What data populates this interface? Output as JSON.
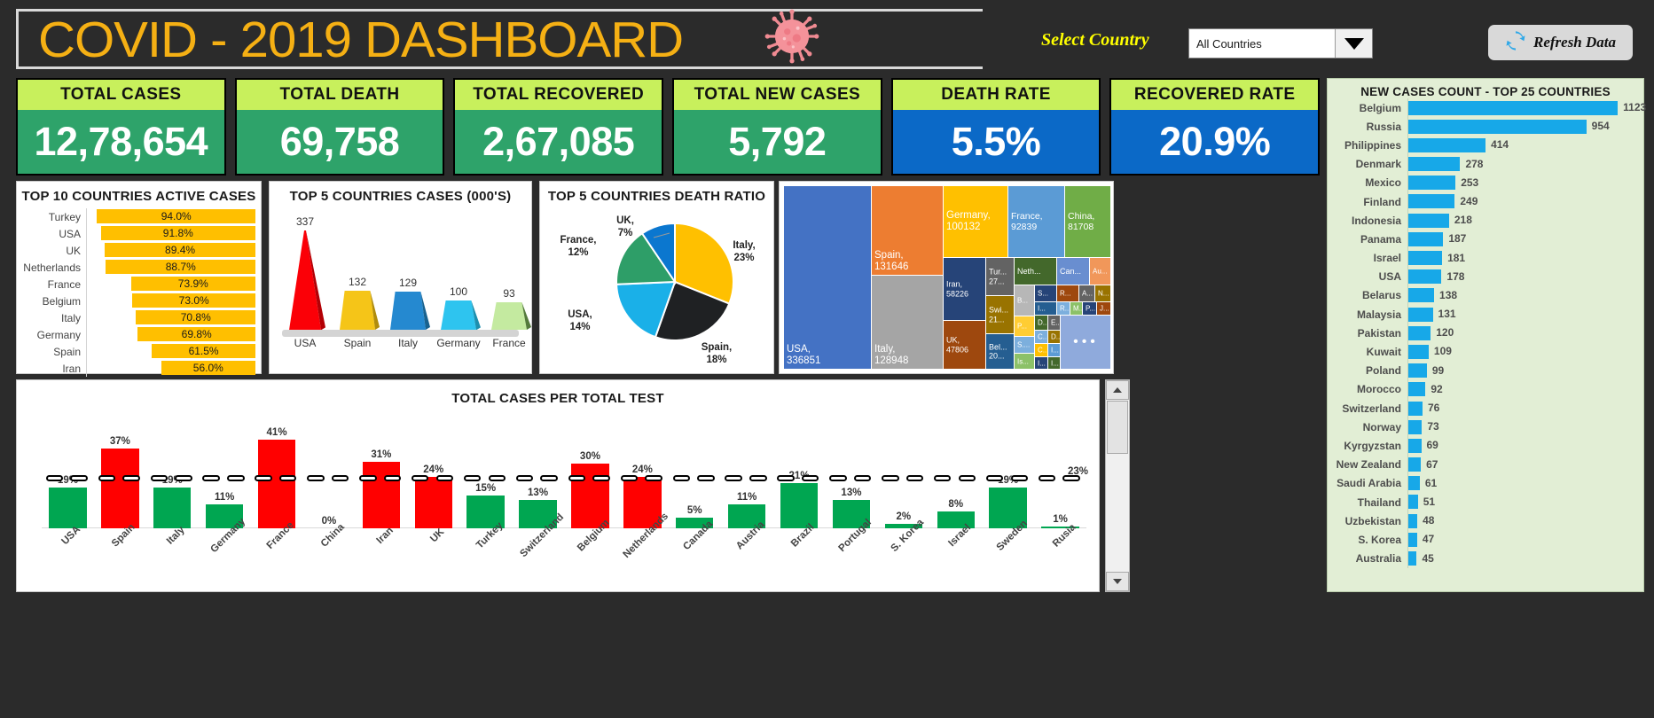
{
  "header": {
    "title": "COVID - 2019 DASHBOARD",
    "virus_icon": "coronavirus-icon",
    "select_country_label": "Select Country",
    "country_value": "All Countries",
    "country_caret_icon": "chevron-down-icon",
    "refresh_label": "Refresh Data",
    "refresh_icon": "refresh-icon"
  },
  "kpis": [
    {
      "caption": "TOTAL CASES",
      "value": "12,78,654",
      "color": "#2ea36a"
    },
    {
      "caption": "TOTAL DEATH",
      "value": "69,758",
      "color": "#2ea36a"
    },
    {
      "caption": "TOTAL RECOVERED",
      "value": "2,67,085",
      "color": "#2ea36a"
    },
    {
      "caption": "TOTAL NEW CASES",
      "value": "5,792",
      "color": "#2ea36a"
    },
    {
      "caption": "DEATH RATE",
      "value": "5.5%",
      "color": "#0b69c7"
    },
    {
      "caption": "RECOVERED RATE",
      "value": "20.9%",
      "color": "#0b69c7"
    }
  ],
  "chart_data": [
    {
      "type": "bar",
      "id": "active_cases",
      "title": "TOP 10 COUNTRIES ACTIVE CASES",
      "orientation": "horizontal",
      "xlabel": "",
      "ylabel": "",
      "grid": false,
      "legend": false,
      "bar_color": "#ffbf00",
      "categories": [
        "Turkey",
        "USA",
        "UK",
        "Netherlands",
        "France",
        "Belgium",
        "Italy",
        "Germany",
        "Spain",
        "Iran"
      ],
      "values": [
        94.0,
        91.8,
        89.4,
        88.7,
        73.9,
        73.0,
        70.8,
        69.8,
        61.5,
        56.0
      ],
      "labels": [
        "94.0%",
        "91.8%",
        "89.4%",
        "88.7%",
        "73.9%",
        "73.0%",
        "70.8%",
        "69.8%",
        "61.5%",
        "56.0%"
      ]
    },
    {
      "type": "bar",
      "id": "top5_cases",
      "title": "TOP 5 COUNTRIES CASES (000'S)",
      "orientation": "vertical",
      "shape": "cone-pyramid",
      "xlabel": "",
      "ylabel": "",
      "grid": false,
      "legend": false,
      "categories": [
        "USA",
        "Spain",
        "Italy",
        "Germany",
        "France"
      ],
      "values": [
        337,
        132,
        129,
        100,
        93
      ],
      "labels": [
        "337",
        "132",
        "129",
        "100",
        "93"
      ],
      "colors": [
        "#fb0007",
        "#f5c518",
        "#2589d0",
        "#2ec4ef",
        "#c4eaa0"
      ]
    },
    {
      "type": "pie",
      "id": "death_ratio",
      "title": "TOP 5 COUNTRIES DEATH RATIO",
      "legend": false,
      "categories": [
        "Italy",
        "Spain",
        "USA",
        "France",
        "UK"
      ],
      "values": [
        23,
        18,
        14,
        12,
        7
      ],
      "labels": [
        "Italy, 23%",
        "Spain, 18%",
        "USA, 14%",
        "France, 12%",
        "UK, 7%"
      ],
      "colors": [
        "#ffc000",
        "#1f2123",
        "#1ab0e8",
        "#2e9e68",
        "#0b77cf"
      ]
    },
    {
      "type": "heatmap",
      "id": "treemap_total_cases",
      "title": "",
      "subtype": "treemap",
      "items": [
        {
          "label": "USA, 336851",
          "value": 336851,
          "color": "#4472c4"
        },
        {
          "label": "Spain, 131646",
          "value": 131646,
          "color": "#ed7d31"
        },
        {
          "label": "Italy, 128948",
          "value": 128948,
          "color": "#a5a5a5"
        },
        {
          "label": "Germany, 100132",
          "value": 100132,
          "color": "#ffc000"
        },
        {
          "label": "France, 92839",
          "value": 92839,
          "color": "#5b9bd5"
        },
        {
          "label": "China, 81708",
          "value": 81708,
          "color": "#70ad47"
        },
        {
          "label": "Iran, 58226",
          "value": 58226,
          "color": "#264478"
        },
        {
          "label": "UK, 47806",
          "value": 47806,
          "color": "#9e480e"
        },
        {
          "label": "Tur... 27...",
          "value": 27069,
          "color": "#636363"
        },
        {
          "label": "Swi... 21...",
          "value": 21100,
          "color": "#997300"
        },
        {
          "label": "Bel... 20...",
          "value": 20814,
          "color": "#255e91"
        },
        {
          "label": "Neth...",
          "value": 18803,
          "color": "#43682b"
        },
        {
          "label": "Can...",
          "value": 16563,
          "color": "#698ed0"
        },
        {
          "label": "Au...",
          "value": 11781,
          "color": "#f1975a"
        },
        {
          "label": "B...",
          "value": 11130,
          "color": "#b7b7b7"
        },
        {
          "label": "P...",
          "value": 11130,
          "color": "#ffcd33"
        },
        {
          "label": "S....",
          "value": 10331,
          "color": "#7cafdd"
        },
        {
          "label": "Is...",
          "value": 9006,
          "color": "#8cc168"
        },
        {
          "label": "S...",
          "value": 8961,
          "color": "#264478"
        },
        {
          "label": "R...",
          "value": 8672,
          "color": "#9e480e"
        },
        {
          "label": "A...",
          "value": 8271,
          "color": "#636363"
        },
        {
          "label": "N...",
          "value": 7997,
          "color": "#997300"
        },
        {
          "label": "I...",
          "value": 7600,
          "color": "#255e91"
        },
        {
          "label": "R...",
          "value": 7000,
          "color": "#7cafdd"
        },
        {
          "label": "M...",
          "value": 6800,
          "color": "#8cc168"
        },
        {
          "label": "P...",
          "value": 6600,
          "color": "#264478"
        },
        {
          "label": "J...",
          "value": 6400,
          "color": "#9e480e"
        },
        {
          "label": "D...",
          "value": 5500,
          "color": "#43682b"
        },
        {
          "label": "E...",
          "value": 5300,
          "color": "#636363"
        },
        {
          "label": "C...",
          "value": 5000,
          "color": "#7cafdd"
        },
        {
          "label": "D..",
          "value": 4800,
          "color": "#997300"
        },
        {
          "label": "C...",
          "value": 4600,
          "color": "#ffc000"
        },
        {
          "label": "I...",
          "value": 4400,
          "color": "#264478"
        },
        {
          "label": "I...",
          "value": 4200,
          "color": "#5b9bd5"
        },
        {
          "label": "I...",
          "value": 4000,
          "color": "#43682b"
        },
        {
          "label": "...",
          "value": 30000,
          "color": "#8faadc"
        }
      ]
    },
    {
      "type": "bar",
      "id": "new_cases_top25",
      "title": "NEW CASES COUNT - TOP 25 COUNTRIES",
      "orientation": "horizontal",
      "xlabel": "",
      "ylabel": "",
      "grid": false,
      "legend": false,
      "bar_color": "#17a8e8",
      "categories": [
        "Belgium",
        "Russia",
        "Philippines",
        "Denmark",
        "Mexico",
        "Finland",
        "Indonesia",
        "Panama",
        "Israel",
        "USA",
        "Belarus",
        "Malaysia",
        "Pakistan",
        "Kuwait",
        "Poland",
        "Morocco",
        "Switzerland",
        "Norway",
        "Kyrgyzstan",
        "New Zealand",
        "Saudi Arabia",
        "Thailand",
        "Uzbekistan",
        "S. Korea",
        "Australia"
      ],
      "values": [
        1123,
        954,
        414,
        278,
        253,
        249,
        218,
        187,
        181,
        178,
        138,
        131,
        120,
        109,
        99,
        92,
        76,
        73,
        69,
        67,
        61,
        51,
        48,
        47,
        45
      ]
    },
    {
      "type": "bar",
      "id": "cases_per_test",
      "title": "TOTAL CASES PER TOTAL TEST",
      "orientation": "vertical",
      "xlabel": "",
      "ylabel": "",
      "grid": false,
      "legend": false,
      "threshold_series_label": "",
      "categories": [
        "USA",
        "Spain",
        "Italy",
        "Germany",
        "France",
        "China",
        "Iran",
        "UK",
        "Turkey",
        "Switzerland",
        "Belgium",
        "Netherlands",
        "Canada",
        "Austria",
        "Brazil",
        "Portugal",
        "S. Korea",
        "Israel",
        "Sweden",
        "Rusia"
      ],
      "values": [
        19,
        37,
        19,
        11,
        41,
        0,
        31,
        24,
        15,
        13,
        30,
        24,
        5,
        11,
        21,
        13,
        2,
        8,
        19,
        1
      ],
      "labels": [
        "19%",
        "37%",
        "19%",
        "11%",
        "41%",
        "0%",
        "31%",
        "24%",
        "15%",
        "13%",
        "30%",
        "24%",
        "5%",
        "11%",
        "21%",
        "13%",
        "2%",
        "8%",
        "19%",
        "1%"
      ],
      "colors": [
        "green",
        "red",
        "green",
        "green",
        "red",
        "green",
        "red",
        "red",
        "green",
        "green",
        "red",
        "red",
        "green",
        "green",
        "green",
        "green",
        "green",
        "green",
        "green",
        "green"
      ],
      "threshold_value": 23,
      "threshold_label": "23%",
      "color_high": "#ff0000",
      "color_low": "#00a651"
    }
  ],
  "scrollbar": {
    "up_icon": "triangle-up-icon",
    "down_icon": "triangle-down-icon"
  }
}
